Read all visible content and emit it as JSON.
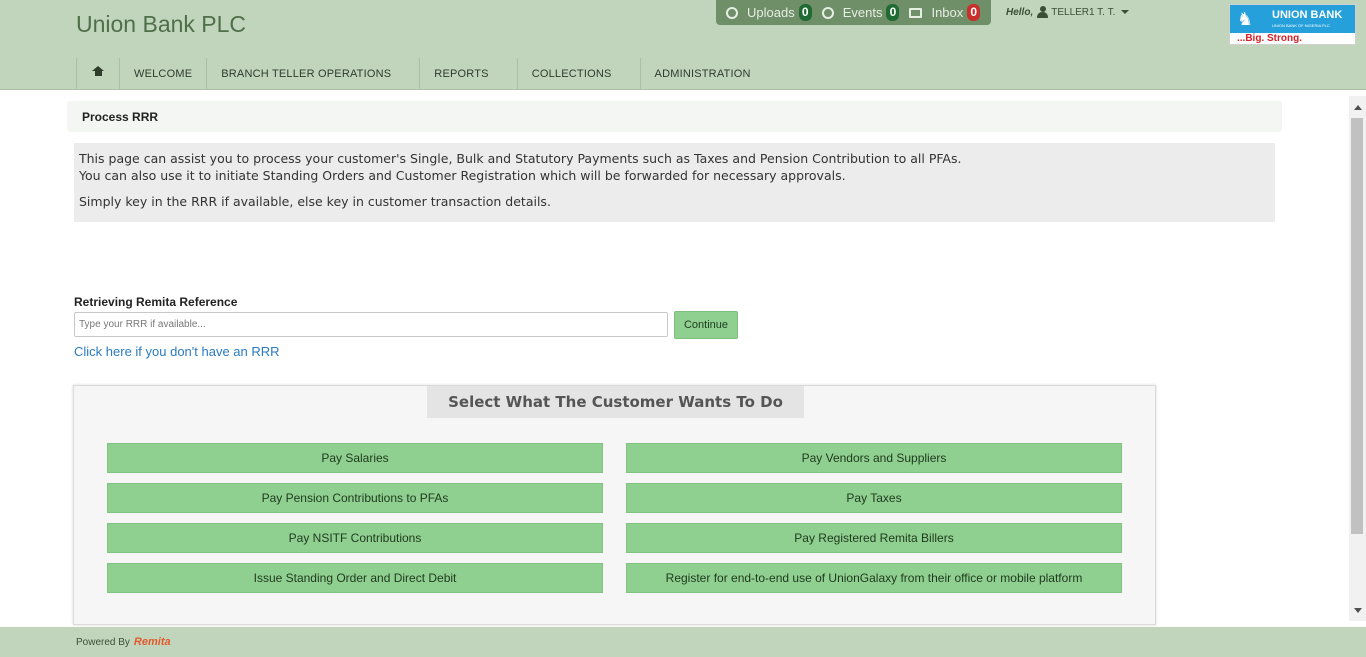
{
  "header": {
    "brand": "Union Bank PLC",
    "notifications": [
      {
        "icon": "upload-icon",
        "label": "Uploads",
        "count": "0"
      },
      {
        "icon": "events-icon",
        "label": "Events",
        "count": "0"
      },
      {
        "icon": "envelope-icon",
        "label": "Inbox",
        "count": "0"
      }
    ],
    "greeting": "Hello,",
    "user": "TELLER1 T. T.",
    "logo": {
      "name": "UNION BANK",
      "subtitle": "UNION BANK OF NIGERIA PLC",
      "tagline": "...Big. Strong."
    }
  },
  "nav": {
    "tabs": [
      "WELCOME",
      "BRANCH TELLER OPERATIONS",
      "REPORTS",
      "COLLECTIONS",
      "ADMINISTRATION"
    ]
  },
  "page": {
    "title": "Process RRR",
    "info_lines": [
      "This page can assist you to process your customer's Single, Bulk and Statutory Payments such as Taxes and Pension Contribution to all PFAs.",
      "You can also use it to initiate Standing Orders and Customer Registration which will be forwarded for necessary approvals.",
      "Simply key in the RRR if available, else key in customer transaction details."
    ],
    "rrr_label": "Retrieving Remita Reference",
    "rrr_placeholder": "Type your RRR if available...",
    "continue_label": "Continue",
    "no_rrr_link": "Click here if you don't have an RRR"
  },
  "actions": {
    "title": "Select What The Customer Wants To Do",
    "left": [
      "Pay Salaries",
      "Pay Pension Contributions to PFAs",
      "Pay NSITF Contributions",
      "Issue Standing Order and Direct Debit"
    ],
    "right": [
      "Pay Vendors and Suppliers",
      "Pay Taxes",
      "Pay Registered Remita Billers",
      "Register for end-to-end use of UnionGalaxy from their office or mobile platform"
    ]
  },
  "footer": {
    "powered_by": "Powered By",
    "brand": "Remita"
  },
  "colors": {
    "header_bg": "#c1d5bd",
    "button_green": "#8fcf8f",
    "badge_green": "#1f6b33",
    "badge_red": "#c9302c",
    "link_blue": "#2a7ac0"
  }
}
